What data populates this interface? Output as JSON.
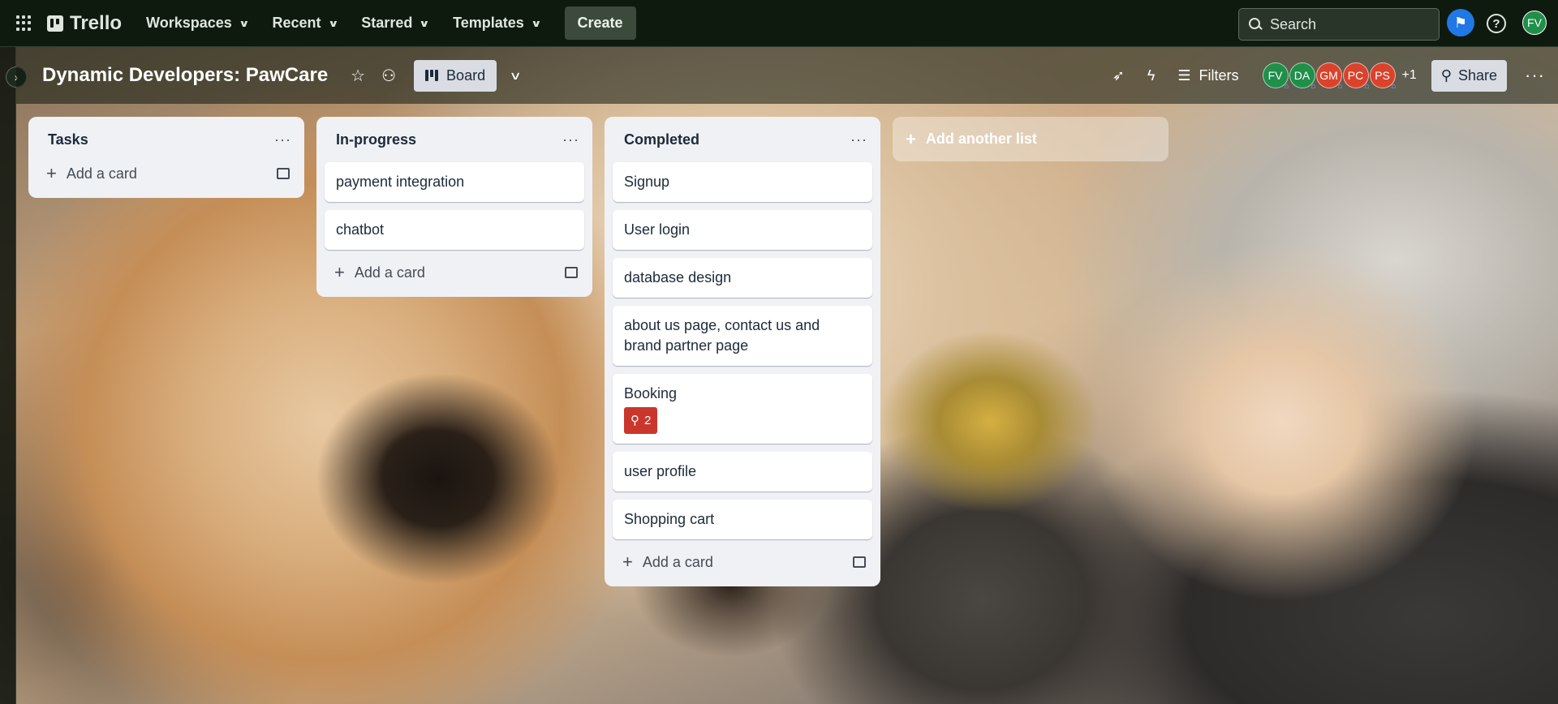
{
  "topbar": {
    "app_name": "Trello",
    "nav": [
      {
        "label": "Workspaces"
      },
      {
        "label": "Recent"
      },
      {
        "label": "Starred"
      },
      {
        "label": "Templates"
      }
    ],
    "create_label": "Create",
    "search_placeholder": "Search",
    "user_initials": "FV"
  },
  "board": {
    "title": "Dynamic Developers: PawCare",
    "view_label": "Board",
    "filters_label": "Filters",
    "members": [
      {
        "initials": "FV",
        "color": "#1f8f4a"
      },
      {
        "initials": "DA",
        "color": "#1f8f4a"
      },
      {
        "initials": "GM",
        "color": "#d9432c"
      },
      {
        "initials": "PC",
        "color": "#d9432c"
      },
      {
        "initials": "PS",
        "color": "#d9432c"
      }
    ],
    "more_members": "+1",
    "share_label": "Share"
  },
  "lists": [
    {
      "title": "Tasks",
      "cards": [],
      "add_label": "Add a card"
    },
    {
      "title": "In-progress",
      "cards": [
        {
          "title": "payment integration"
        },
        {
          "title": "chatbot"
        }
      ],
      "add_label": "Add a card"
    },
    {
      "title": "Completed",
      "cards": [
        {
          "title": "Signup"
        },
        {
          "title": "User login"
        },
        {
          "title": "database design"
        },
        {
          "title": "about us page, contact us and brand partner page"
        },
        {
          "title": "Booking",
          "badge": "2"
        },
        {
          "title": "user profile"
        },
        {
          "title": "Shopping cart"
        }
      ],
      "add_label": "Add a card"
    }
  ],
  "add_list_label": "Add another list",
  "colors": {
    "topbar_bg": "#0f1a0e",
    "list_bg": "#f0f1f4",
    "badge_red": "#c9372c",
    "accent_blue": "#1f78e5"
  }
}
